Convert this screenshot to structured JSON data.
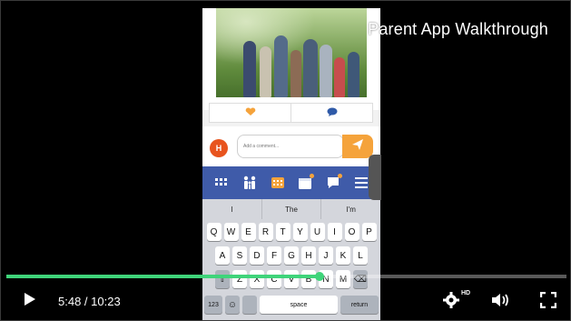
{
  "player": {
    "title": "Parent App Walkthrough",
    "time": "5:48 / 10:23",
    "progress": 0.559,
    "hd_badge": "HD"
  },
  "app": {
    "avatar_initial": "H",
    "comment_placeholder": "Add a comment...",
    "predictions": [
      "I",
      "The",
      "I'm"
    ],
    "keyboard": {
      "row1": [
        "Q",
        "W",
        "E",
        "R",
        "T",
        "Y",
        "U",
        "I",
        "O",
        "P"
      ],
      "row2": [
        "A",
        "S",
        "D",
        "F",
        "G",
        "H",
        "J",
        "K",
        "L"
      ],
      "row3": [
        "Z",
        "X",
        "C",
        "V",
        "B",
        "N",
        "M"
      ],
      "numbers": "123",
      "space": "space",
      "return": "return"
    }
  },
  "colors": {
    "accent": "#3fd47a",
    "nav_blue": "#3f5ba9",
    "orange": "#f5a33b",
    "avatar": "#e8541e"
  },
  "icons": [
    "play-icon",
    "settings-icon",
    "volume-icon",
    "fullscreen-icon",
    "send-icon",
    "heart-icon",
    "comment-icon",
    "grid-icon",
    "family-icon",
    "directory-icon",
    "calendar-icon",
    "chat-icon",
    "menu-icon",
    "emoji-icon",
    "shift-icon",
    "backspace-icon"
  ]
}
